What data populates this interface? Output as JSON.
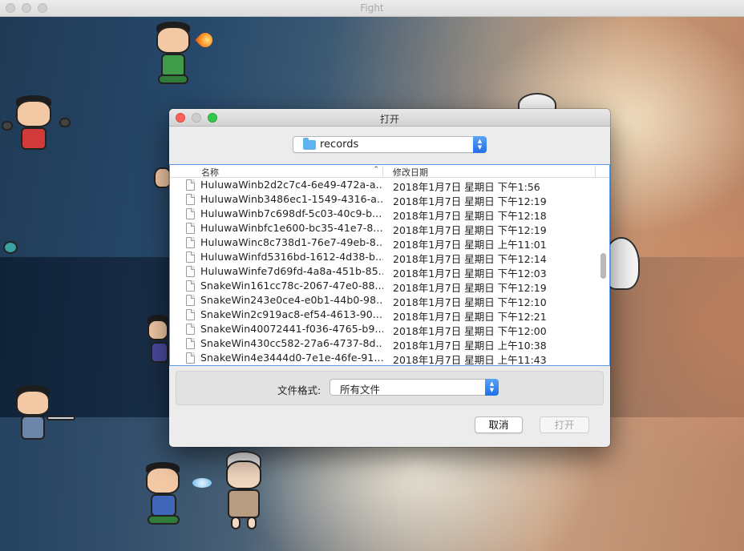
{
  "window": {
    "title": "Fight"
  },
  "dialog": {
    "title": "打开",
    "folder": "records",
    "columns": {
      "name": "名称",
      "date": "修改日期"
    },
    "files": [
      {
        "name": "HuluwaWinb2d2c7c4-6e49-472a-a...",
        "date": "2018年1月7日 星期日 下午1:56"
      },
      {
        "name": "HuluwaWinb3486ec1-1549-4316-a...",
        "date": "2018年1月7日 星期日 下午12:19"
      },
      {
        "name": "HuluwaWinb7c698df-5c03-40c9-b...",
        "date": "2018年1月7日 星期日 下午12:18"
      },
      {
        "name": "HuluwaWinbfc1e600-bc35-41e7-8...",
        "date": "2018年1月7日 星期日 下午12:19"
      },
      {
        "name": "HuluwaWinc8c738d1-76e7-49eb-8...",
        "date": "2018年1月7日 星期日 上午11:01"
      },
      {
        "name": "HuluwaWinfd5316bd-1612-4d38-b...",
        "date": "2018年1月7日 星期日 下午12:14"
      },
      {
        "name": "HuluwaWinfe7d69fd-4a8a-451b-85...",
        "date": "2018年1月7日 星期日 下午12:03"
      },
      {
        "name": "SnakeWin161cc78c-2067-47e0-88...",
        "date": "2018年1月7日 星期日 下午12:19"
      },
      {
        "name": "SnakeWin243e0ce4-e0b1-44b0-98...",
        "date": "2018年1月7日 星期日 下午12:10"
      },
      {
        "name": "SnakeWin2c919ac8-ef54-4613-90...",
        "date": "2018年1月7日 星期日 下午12:21"
      },
      {
        "name": "SnakeWin40072441-f036-4765-b9...",
        "date": "2018年1月7日 星期日 下午12:00"
      },
      {
        "name": "SnakeWin430cc582-27a6-4737-8d...",
        "date": "2018年1月7日 星期日 上午10:38"
      },
      {
        "name": "SnakeWin4e3444d0-7e1e-46fe-91...",
        "date": "2018年1月7日 星期日 上午11:43"
      }
    ],
    "format_label": "文件格式:",
    "format_value": "所有文件",
    "cancel_label": "取消",
    "open_label": "打开"
  },
  "icons": {
    "folder": "folder-icon",
    "file": "file-icon",
    "sort": "chevron-up-icon",
    "popup": "up-down-chevron-icon"
  },
  "colors": {
    "accent": "#1f6fe8",
    "close": "#fc605b",
    "zoom": "#34c84a"
  }
}
